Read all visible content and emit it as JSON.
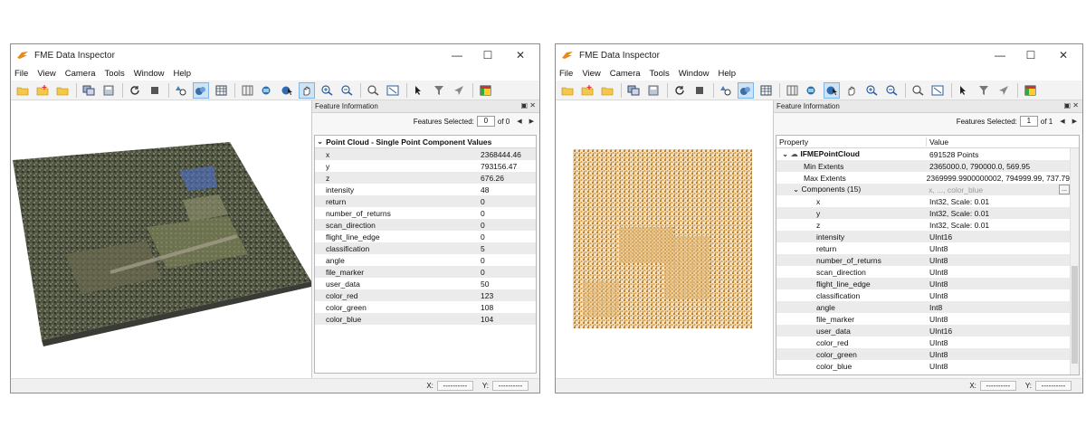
{
  "left": {
    "title": "FME Data Inspector",
    "menu": [
      "File",
      "View",
      "Camera",
      "Tools",
      "Window",
      "Help"
    ],
    "panel": {
      "title": "Feature Information",
      "features_selected_label": "Features Selected:",
      "selected_value": "0",
      "of_label": "of 0",
      "group_title": "Point Cloud - Single Point Component Values",
      "rows": [
        {
          "name": "x",
          "value": "2368444.46"
        },
        {
          "name": "y",
          "value": "793156.47"
        },
        {
          "name": "z",
          "value": "676.26"
        },
        {
          "name": "intensity",
          "value": "48"
        },
        {
          "name": "return",
          "value": "0"
        },
        {
          "name": "number_of_returns",
          "value": "0"
        },
        {
          "name": "scan_direction",
          "value": "0"
        },
        {
          "name": "flight_line_edge",
          "value": "0"
        },
        {
          "name": "classification",
          "value": "5"
        },
        {
          "name": "angle",
          "value": "0"
        },
        {
          "name": "file_marker",
          "value": "0"
        },
        {
          "name": "user_data",
          "value": "50"
        },
        {
          "name": "color_red",
          "value": "123"
        },
        {
          "name": "color_green",
          "value": "108"
        },
        {
          "name": "color_blue",
          "value": "104"
        }
      ]
    },
    "status": {
      "x_label": "X:",
      "x_value": "----------",
      "y_label": "Y:",
      "y_value": "----------"
    }
  },
  "right": {
    "title": "FME Data Inspector",
    "menu": [
      "File",
      "View",
      "Camera",
      "Tools",
      "Window",
      "Help"
    ],
    "panel": {
      "title": "Feature Information",
      "features_selected_label": "Features Selected:",
      "selected_value": "1",
      "of_label": "of 1",
      "col_property": "Property",
      "col_value": "Value",
      "root": {
        "name": "IFMEPointCloud",
        "value": "691528 Points"
      },
      "min_extents": {
        "name": "Min Extents",
        "value": "2365000.0, 790000.0, 569.95"
      },
      "max_extents": {
        "name": "Max Extents",
        "value": "2369999.9900000002, 794999.99, 737.79"
      },
      "components": {
        "name": "Components (15)",
        "value": "x, ..., color_blue",
        "btn": "..."
      },
      "rows": [
        {
          "name": "x",
          "value": "Int32, Scale: 0.01"
        },
        {
          "name": "y",
          "value": "Int32, Scale: 0.01"
        },
        {
          "name": "z",
          "value": "Int32, Scale: 0.01"
        },
        {
          "name": "intensity",
          "value": "UInt16"
        },
        {
          "name": "return",
          "value": "UInt8"
        },
        {
          "name": "number_of_returns",
          "value": "UInt8"
        },
        {
          "name": "scan_direction",
          "value": "UInt8"
        },
        {
          "name": "flight_line_edge",
          "value": "UInt8"
        },
        {
          "name": "classification",
          "value": "UInt8"
        },
        {
          "name": "angle",
          "value": "Int8"
        },
        {
          "name": "file_marker",
          "value": "UInt8"
        },
        {
          "name": "user_data",
          "value": "UInt16"
        },
        {
          "name": "color_red",
          "value": "UInt8"
        },
        {
          "name": "color_green",
          "value": "UInt8"
        },
        {
          "name": "color_blue",
          "value": "UInt8"
        }
      ]
    },
    "status": {
      "x_label": "X:",
      "x_value": "----------",
      "y_label": "Y:",
      "y_value": "----------"
    }
  },
  "colors": {
    "accent": "#1f6fb8",
    "pointcloud_orange": "#c8862a",
    "panel_bg": "#f7f7f7"
  }
}
